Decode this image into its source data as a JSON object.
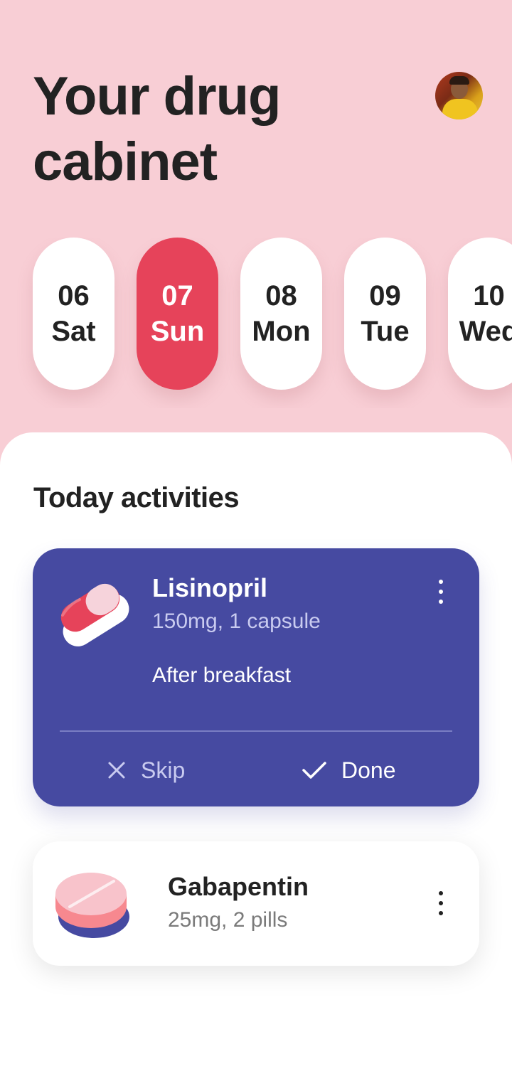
{
  "header": {
    "title": "Your drug cabinet",
    "avatar_icon": "user-avatar-photo"
  },
  "calendar": {
    "days": [
      {
        "date": "06",
        "day": "Sat",
        "selected": false
      },
      {
        "date": "07",
        "day": "Sun",
        "selected": true
      },
      {
        "date": "08",
        "day": "Mon",
        "selected": false
      },
      {
        "date": "09",
        "day": "Tue",
        "selected": false
      },
      {
        "date": "10",
        "day": "Wed",
        "selected": false
      }
    ]
  },
  "activities": {
    "title": "Today activities",
    "items": [
      {
        "name": "Lisinopril",
        "dosage": "150mg, 1 capsule",
        "note": "After breakfast",
        "icon": "capsule-icon",
        "skip_label": "Skip",
        "done_label": "Done",
        "skip_icon": "close-icon",
        "done_icon": "check-icon",
        "more_icon": "more-vertical-icon"
      },
      {
        "name": "Gabapentin",
        "dosage": "25mg, 2 pills",
        "icon": "pill-tablet-icon",
        "more_icon": "more-vertical-icon"
      }
    ]
  },
  "colors": {
    "background": "#f8ced5",
    "accent": "#e6435a",
    "card_primary": "#464aa1",
    "text_dark": "#222222",
    "surface": "#ffffff"
  }
}
